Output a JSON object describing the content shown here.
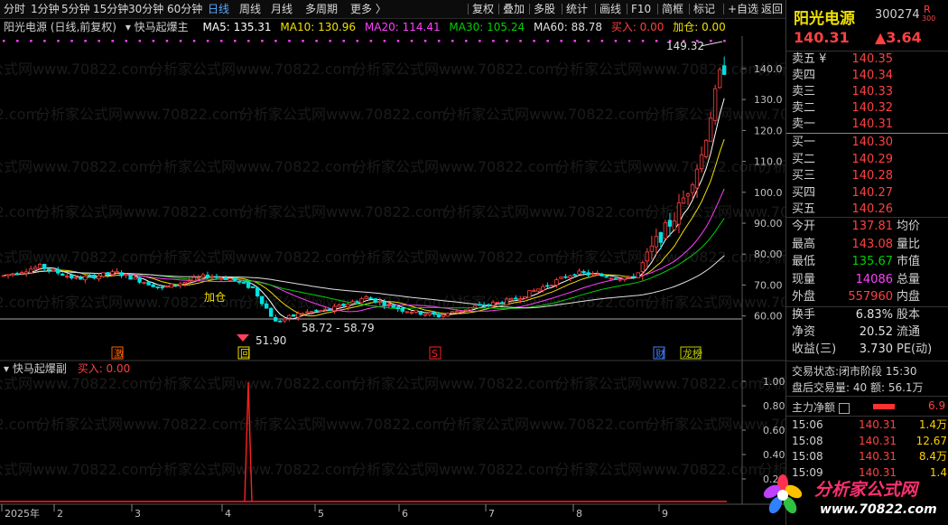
{
  "toolbar": {
    "periods": [
      "分时",
      "1分钟",
      "5分钟",
      "15分钟",
      "30分钟",
      "60分钟",
      "日线",
      "周线",
      "月线",
      "多周期",
      "更多 〉"
    ],
    "active_period": "日线",
    "tools": [
      "复权",
      "叠加",
      "多股",
      "统计",
      "画线",
      "F10",
      "简框",
      "标记",
      "+自选",
      "返回"
    ]
  },
  "header": {
    "stock_label": "阳光电源 (日线,前复权)",
    "indicator_name": "快马起爆主",
    "ma5": "MA5: 135.31",
    "ma10": "MA10: 130.96",
    "ma20": "MA20: 114.41",
    "ma30": "MA30: 105.24",
    "ma60": "MA60: 88.78",
    "buy": "买入: 0.00",
    "add": "加仓: 0.00"
  },
  "sub_header": {
    "indicator_name": "快马起爆副",
    "buy": "买入: 0.00"
  },
  "annotations": {
    "high": "149.32",
    "low": "51.90",
    "range": "58.72 - 58.79",
    "add_label": "加仓",
    "event_jie": "激",
    "event_hui": "回",
    "event_s": "S",
    "event_cai": "财",
    "event_long": "龙榜"
  },
  "watermark": "分析家公式网www.70822.com",
  "price_axis": [
    "140.0",
    "130.0",
    "120.0",
    "110.0",
    "100.0",
    "90.00",
    "80.00",
    "70.00",
    "60.00"
  ],
  "sub_axis": [
    "1.00",
    "0.80",
    "0.60",
    "0.40",
    "0.20"
  ],
  "date_axis": [
    "2025年",
    "2",
    "3",
    "4",
    "5",
    "6",
    "7",
    "8",
    "9"
  ],
  "panel": {
    "name": "阳光电源",
    "code": "300274",
    "badge": "R",
    "badge_sub": "300",
    "price": "140.31",
    "change": "▲3.64",
    "asks": [
      {
        "label": "卖五 ¥",
        "price": "140.35"
      },
      {
        "label": "卖四",
        "price": "140.34"
      },
      {
        "label": "卖三",
        "price": "140.33"
      },
      {
        "label": "卖二",
        "price": "140.32"
      },
      {
        "label": "卖一",
        "price": "140.31"
      }
    ],
    "bids": [
      {
        "label": "买一",
        "price": "140.30"
      },
      {
        "label": "买二",
        "price": "140.29"
      },
      {
        "label": "买三",
        "price": "140.28"
      },
      {
        "label": "买四",
        "price": "140.27"
      },
      {
        "label": "买五",
        "price": "140.26"
      }
    ],
    "stats": [
      {
        "label": "今开",
        "value": "137.81",
        "label2": "均价"
      },
      {
        "label": "最高",
        "value": "143.08",
        "label2": "量比"
      },
      {
        "label": "最低",
        "value": "135.67",
        "label2": "市值"
      },
      {
        "label": "现量",
        "value": "14086",
        "label2": "总量"
      },
      {
        "label": "外盘",
        "value": "557960",
        "label2": "内盘"
      }
    ],
    "stats2": [
      {
        "label": "换手",
        "value": "6.83%",
        "label2": "股本"
      },
      {
        "label": "净资",
        "value": "20.52",
        "label2": "流通"
      },
      {
        "label": "收益(三)",
        "value": "3.730",
        "label2": "PE(动)"
      }
    ],
    "trade_status_label": "交易状态:",
    "trade_status": "闭市阶段",
    "trade_time": "15:30",
    "after_hours": "盘后交易量: 40",
    "after_amount": "额: 56.1万",
    "main_flow_label": "主力净额",
    "main_flow_value": "6.9",
    "ticks": [
      {
        "time": "15:06",
        "price": "140.31",
        "vol": "1.4万"
      },
      {
        "time": "15:08",
        "price": "140.31",
        "vol": "12.67"
      },
      {
        "time": "15:08",
        "price": "140.31",
        "vol": "8.4万"
      },
      {
        "time": "15:09",
        "price": "140.31",
        "vol": "1.4"
      }
    ]
  },
  "logo": {
    "text": "分析家公式网",
    "url": "www.70822.com"
  },
  "colors": {
    "up": "#ff4040",
    "down": "#00e0e0",
    "ma5": "#ffffff",
    "ma10": "#f0e000",
    "ma20": "#ff40ff",
    "ma30": "#00d000",
    "ma60": "#e0e0e0",
    "accent": "#5aa8ff"
  }
}
